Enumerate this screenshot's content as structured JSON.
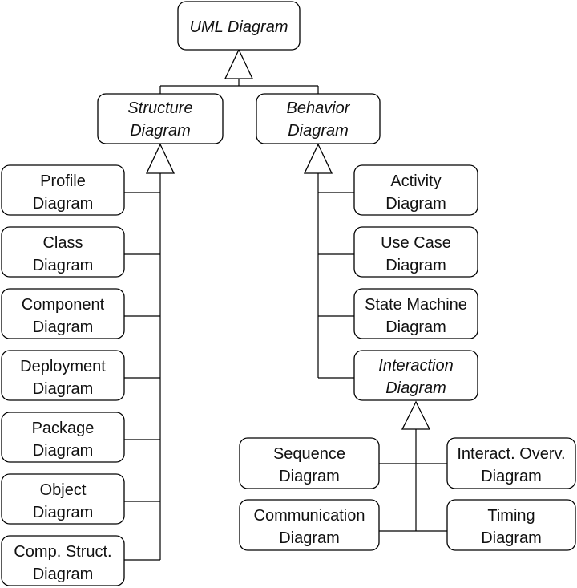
{
  "root": {
    "line1": "UML Diagram",
    "abstract": true
  },
  "structure": {
    "line1": "Structure",
    "line2": "Diagram",
    "abstract": true,
    "children": [
      {
        "line1": "Profile",
        "line2": "Diagram"
      },
      {
        "line1": "Class",
        "line2": "Diagram"
      },
      {
        "line1": "Component",
        "line2": "Diagram"
      },
      {
        "line1": "Deployment",
        "line2": "Diagram"
      },
      {
        "line1": "Package",
        "line2": "Diagram"
      },
      {
        "line1": "Object",
        "line2": "Diagram"
      },
      {
        "line1": "Comp. Struct.",
        "line2": "Diagram"
      }
    ]
  },
  "behavior": {
    "line1": "Behavior",
    "line2": "Diagram",
    "abstract": true,
    "children": [
      {
        "line1": "Activity",
        "line2": "Diagram"
      },
      {
        "line1": "Use Case",
        "line2": "Diagram"
      },
      {
        "line1": "State Machine",
        "line2": "Diagram"
      }
    ]
  },
  "interaction": {
    "line1": "Interaction",
    "line2": "Diagram",
    "abstract": true,
    "children": [
      {
        "line1": "Sequence",
        "line2": "Diagram"
      },
      {
        "line1": "Interact. Overv.",
        "line2": "Diagram"
      },
      {
        "line1": "Communication",
        "line2": "Diagram"
      },
      {
        "line1": "Timing",
        "line2": "Diagram"
      }
    ]
  }
}
